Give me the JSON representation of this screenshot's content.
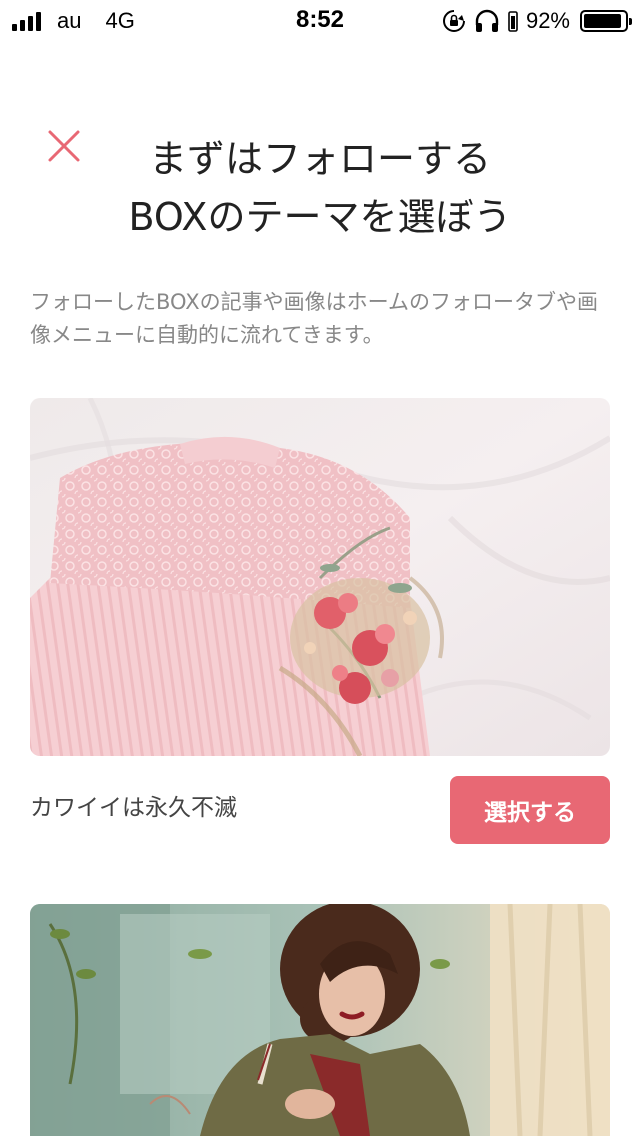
{
  "status_bar": {
    "carrier": "au",
    "network": "4G",
    "time": "8:52",
    "battery_percent": "92%",
    "battery_level": 0.92,
    "icons": [
      "signal-icon",
      "orientation-lock-icon",
      "headphones-icon",
      "battery-icon"
    ]
  },
  "header": {
    "close_icon": "close-icon",
    "title_line1": "まずはフォローする",
    "title_line2": "BOXのテーマを選ぼう"
  },
  "description": "フォローしたBOXの記事や画像はホームのフォロータブや画像メニューに自動的に流れてきます。",
  "cards": [
    {
      "image": "pink-lace-dress-with-dried-flowers",
      "label": "カワイイは永久不滅",
      "button_label": "選択する"
    },
    {
      "image": "woman-in-olive-bomber-jacket"
    }
  ],
  "colors": {
    "accent": "#e86874",
    "title_text": "#222222",
    "description_text": "#888888"
  }
}
